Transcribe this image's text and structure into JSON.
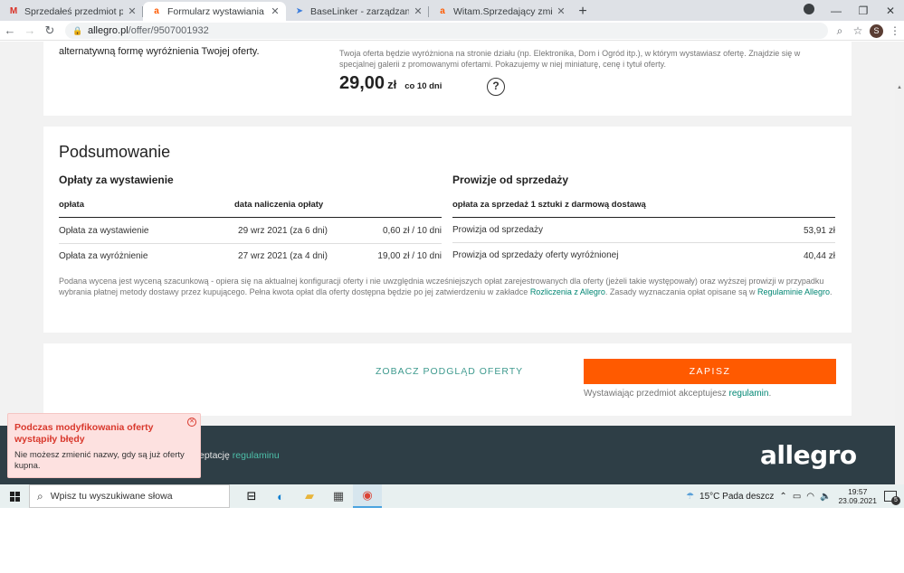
{
  "browser": {
    "tabs": [
      {
        "title": "Sprzedałeś przedmiot przez Kup",
        "icon": "gmail-icon",
        "active": false
      },
      {
        "title": "Formularz wystawiania",
        "icon": "allegro-icon",
        "active": true
      },
      {
        "title": "BaseLinker - zarządzanie sprzeda",
        "icon": "baselinker-icon",
        "active": false
      },
      {
        "title": "Witam.Sprzedający zmienił tytuł",
        "icon": "allegro-icon",
        "active": false
      }
    ],
    "url_host": "allegro.pl",
    "url_path": "/offer/9507001932",
    "profile_initial": "S"
  },
  "promo": {
    "left_text": "alternatywną formę wyróżnienia Twojej oferty.",
    "description": "Twoja oferta będzie wyróżniona na stronie działu (np. Elektronika, Dom i Ogród itp.), w którym wystawiasz ofertę. Znajdzie się w specjalnej galerii z promowanymi ofertami. Pokazujemy w niej miniaturę, cenę i tytuł oferty.",
    "price_main": "29,00",
    "price_currency": "zł",
    "price_period": "co 10 dni",
    "help": "?"
  },
  "summary": {
    "title": "Podsumowanie",
    "fees": {
      "title": "Opłaty za wystawienie",
      "col_fee": "opłata",
      "col_date": "data naliczenia opłaty",
      "rows": [
        {
          "name": "Opłata za wystawienie",
          "date": "29 wrz 2021 (za 6 dni)",
          "amount": "0,60 zł / 10 dni"
        },
        {
          "name": "Opłata za wyróżnienie",
          "date": "27 wrz 2021 (za 4 dni)",
          "amount": "19,00 zł / 10 dni"
        }
      ]
    },
    "commissions": {
      "title": "Prowizje od sprzedaży",
      "col_header": "opłata za sprzedaż 1 sztuki z darmową dostawą",
      "rows": [
        {
          "name": "Prowizja od sprzedaży",
          "amount": "53,91 zł"
        },
        {
          "name": "Prowizja od sprzedaży oferty wyróżnionej",
          "amount": "40,44 zł"
        }
      ]
    },
    "note_part1": "Podana wycena jest wyceną szacunkową - opiera się na aktualnej konfiguracji oferty i nie uwzględnia wcześniejszych opłat zarejestrowanych dla oferty (jeżeli takie występowały) oraz wyższej prowizji w przypadku wybrania płatnej metody dostawy przez kupującego. Pełna kwota opłat dla oferty dostępna będzie po jej zatwierdzeniu w zakładce ",
    "note_link1": "Rozliczenia z Allegro",
    "note_part2": ". Zasady wyznaczania opłat opisane są w ",
    "note_link2": "Regulaminie Allegro",
    "note_part3": "."
  },
  "actions": {
    "preview": "ZOBACZ PODGLĄD OFERTY",
    "save": "ZAPISZ",
    "accept_text": "Wystawiając przedmiot akceptujesz ",
    "accept_link": "regulamin",
    "accept_end": "."
  },
  "footer": {
    "text": "eptację ",
    "link": "regulaminu",
    "logo": "allegro"
  },
  "toast": {
    "title": "Podczas modyfikowania oferty wystąpiły błędy",
    "message": "Nie możesz zmienić nazwy, gdy są już oferty kupna."
  },
  "taskbar": {
    "search_placeholder": "Wpisz tu wyszukiwane słowa",
    "weather": "15°C  Pada deszcz",
    "time": "19:57",
    "date": "23.09.2021",
    "notifications": "5"
  },
  "colors": {
    "accent": "#ff5a00",
    "link": "#008673",
    "error": "#d9382c",
    "footer_bg": "#2e3e46"
  }
}
